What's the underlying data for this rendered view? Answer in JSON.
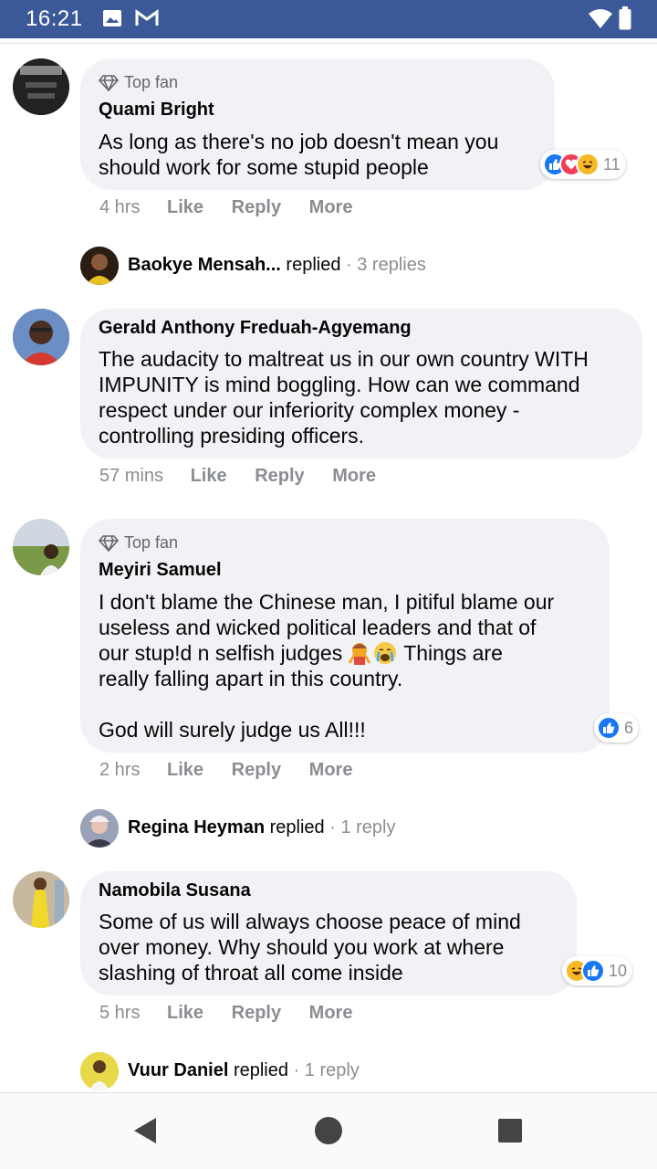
{
  "status_bar": {
    "time": "16:21"
  },
  "comments": [
    {
      "badge": "Top fan",
      "author": "Quami Bright",
      "text": "As long as there's no job doesn't mean you\nshould work for some stupid people",
      "time": "4 hrs",
      "reaction_count": "11",
      "reactions": [
        "like-icon",
        "love-icon",
        "haha-icon"
      ]
    },
    {
      "badge": "",
      "author": "Gerald Anthony Freduah-Agyemang",
      "text": "The audacity to maltreat us in our own country WITH\nIMPUNITY is mind boggling. How can we command\nrespect under our inferiority complex money -\ncontrolling presiding officers.",
      "time": "57 mins",
      "reaction_count": "",
      "reactions": []
    },
    {
      "badge": "Top fan",
      "author": "Meyiri Samuel",
      "text_line1": "I don't blame the Chinese man, I pitiful blame our",
      "text_line2": "useless and wicked political leaders and that of",
      "text_line3a": "our stup!d n selfish judges",
      "text_line3b": "Things are",
      "text_line4": "really falling apart in this country.",
      "text_line5": "God will surely judge us All!!!",
      "time": "2 hrs",
      "reaction_count": "6",
      "reactions": [
        "like-icon"
      ]
    },
    {
      "badge": "",
      "author": "Namobila Susana",
      "text": "Some of us will always choose peace of mind\nover money. Why should you work at where\nslashing of throat all come inside",
      "time": "5 hrs",
      "reaction_count": "10",
      "reactions": [
        "haha-icon",
        "like-icon"
      ]
    }
  ],
  "actions": {
    "like": "Like",
    "reply": "Reply",
    "more": "More"
  },
  "replies": [
    {
      "name": "Baokye Mensah...",
      "verb": "replied",
      "count": "· 3 replies"
    },
    {
      "name": "Regina Heyman",
      "verb": "replied",
      "count": "· 1 reply"
    },
    {
      "name": "Vuur Daniel",
      "verb": "replied",
      "count": "· 1 reply"
    }
  ],
  "colors": {
    "status_bar": "#3b5998",
    "bubble": "#f0f2f5",
    "like_blue": "#1877f2",
    "love_red": "#f33e58",
    "haha_yellow": "#f7b928"
  }
}
